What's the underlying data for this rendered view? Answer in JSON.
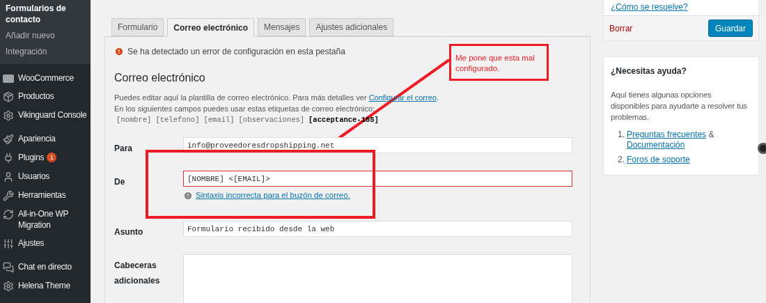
{
  "sidebar": {
    "submenu": [
      {
        "label": "Formularios de contacto",
        "selected": true
      },
      {
        "label": "Añadir nuevo",
        "selected": false
      },
      {
        "label": "Integración",
        "selected": false
      }
    ],
    "groups": [
      [
        {
          "label": "WooCommerce"
        },
        {
          "label": "Productos"
        },
        {
          "label": "Vikinguard Console"
        }
      ],
      [
        {
          "label": "Apariencia"
        },
        {
          "label": "Plugins",
          "badge": "1"
        },
        {
          "label": "Usuarios"
        },
        {
          "label": "Herramientas"
        },
        {
          "label": "All-in-One WP Migration"
        },
        {
          "label": "Ajustes"
        }
      ],
      [
        {
          "label": "Chat en directo"
        },
        {
          "label": "Helena Theme"
        }
      ]
    ]
  },
  "tabs": [
    {
      "label": "Formulario",
      "selected": false
    },
    {
      "label": "Correo electrónico",
      "selected": true
    },
    {
      "label": "Mensajes",
      "selected": false
    },
    {
      "label": "Ajustes adicionales",
      "selected": false
    }
  ],
  "notice": "Se ha detectado un error de configuración en esta pestaña",
  "section": {
    "title": "Correo electrónico",
    "description": "Puedes editar aquí la plantilla de correo electrónico. Para más detalles ver",
    "description_link": "Configurar el correo",
    "description_end": ".",
    "tags_intro": "En los siguientes campos puedes usar estas etiquetas de correo electrónico:",
    "tags": [
      {
        "label": "[nombre]",
        "used": false
      },
      {
        "label": "[telefono]",
        "used": false
      },
      {
        "label": "[email]",
        "used": false
      },
      {
        "label": "[observaciones]",
        "used": false
      },
      {
        "label": "[acceptance-185]",
        "used": true
      }
    ]
  },
  "fields": [
    {
      "label": "Para",
      "kind": "input",
      "value": "info@proveedoresdropshipping.net"
    },
    {
      "label": "De",
      "kind": "input",
      "value": "[NOMBRE] <[EMAIL]>",
      "invalid": true,
      "error": "Sintaxis incorrecta para el buzón de correo."
    },
    {
      "label": "Asunto",
      "kind": "input",
      "value": "Formulario recibido desde la web"
    },
    {
      "label": "Cabeceras adicionales",
      "kind": "textarea"
    }
  ],
  "publish_box": {
    "link": "¿Cómo se resuelve?",
    "delete": "Borrar",
    "save": "Guardar"
  },
  "help_box": {
    "title": "¿Necesitas ayuda?",
    "text": "Aquí tienes algunas opciones disponibles para ayudarte a resolver tus problemas.",
    "items": [
      {
        "number": "1.",
        "links": [
          "Preguntas frecuentes",
          "Documentación"
        ],
        "joiner": "&"
      },
      {
        "number": "2.",
        "links": [
          "Foros de soporte"
        ]
      }
    ]
  },
  "annotation": {
    "text": "Me pone que esta mal configurado."
  }
}
